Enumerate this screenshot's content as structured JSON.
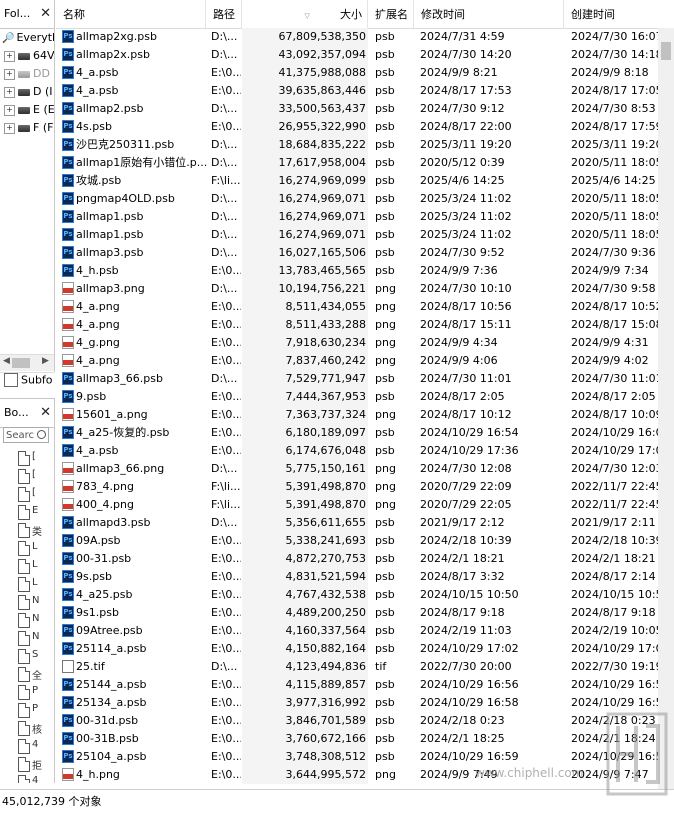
{
  "folders": {
    "title": "Fol...",
    "items": [
      {
        "expander": "",
        "icon": "search-root-icon",
        "label": "Everyth"
      },
      {
        "expander": "+",
        "icon": "network-drive-icon",
        "label": "64V"
      },
      {
        "expander": "+",
        "icon": "drive-icon",
        "label": "DD"
      },
      {
        "expander": "+",
        "icon": "drive-icon",
        "label": "D (I"
      },
      {
        "expander": "+",
        "icon": "drive-icon",
        "label": "E (E"
      },
      {
        "expander": "+",
        "icon": "drive-icon",
        "label": "F (F"
      }
    ],
    "subfolders_label": "Subfo"
  },
  "bookmarks": {
    "title": "Bo...",
    "search_placeholder": "Searc",
    "items": [
      "[",
      "[",
      "[",
      "E",
      "类",
      "L",
      "L",
      "L",
      "N",
      "N",
      "N",
      "S",
      "全",
      "P",
      "P",
      "核",
      "4",
      "拒",
      "4"
    ]
  },
  "columns": {
    "name": "名称",
    "path": "路径",
    "size": "大小",
    "ext": "扩展名",
    "modified": "修改时间",
    "created": "创建时间"
  },
  "files": [
    {
      "name": "allmap2xg.psb",
      "path": "D:\\...",
      "size": "67,809,538,350",
      "ext": "psb",
      "modified": "2024/7/31 4:59",
      "created": "2024/7/30 16:07",
      "icon": "psb"
    },
    {
      "name": "allmap2x.psb",
      "path": "D:\\...",
      "size": "43,092,357,094",
      "ext": "psb",
      "modified": "2024/7/30 14:20",
      "created": "2024/7/30 14:18",
      "icon": "psb"
    },
    {
      "name": "4_a.psb",
      "path": "E:\\0...",
      "size": "41,375,988,088",
      "ext": "psb",
      "modified": "2024/9/9 8:21",
      "created": "2024/9/9 8:18",
      "icon": "psb"
    },
    {
      "name": "4_a.psb",
      "path": "E:\\0...",
      "size": "39,635,863,446",
      "ext": "psb",
      "modified": "2024/8/17 17:53",
      "created": "2024/8/17 17:05",
      "icon": "psb"
    },
    {
      "name": "allmap2.psb",
      "path": "D:\\...",
      "size": "33,500,563,437",
      "ext": "psb",
      "modified": "2024/7/30 9:12",
      "created": "2024/7/30 8:53",
      "icon": "psb"
    },
    {
      "name": "4s.psb",
      "path": "E:\\0...",
      "size": "26,955,322,990",
      "ext": "psb",
      "modified": "2024/8/17 22:00",
      "created": "2024/8/17 17:59",
      "icon": "psb"
    },
    {
      "name": "沙巴克250311.psb",
      "path": "D:\\...",
      "size": "18,684,835,222",
      "ext": "psb",
      "modified": "2025/3/11 19:20",
      "created": "2025/3/11 19:20",
      "icon": "psb"
    },
    {
      "name": "allmap1原始有小错位.p...",
      "path": "D:\\...",
      "size": "17,617,958,004",
      "ext": "psb",
      "modified": "2020/5/12 0:39",
      "created": "2020/5/11 18:05",
      "icon": "psb"
    },
    {
      "name": "攻城.psb",
      "path": "F:\\li...",
      "size": "16,274,969,099",
      "ext": "psb",
      "modified": "2025/4/6 14:25",
      "created": "2025/4/6 14:25",
      "icon": "psb"
    },
    {
      "name": "pngmap4OLD.psb",
      "path": "D:\\...",
      "size": "16,274,969,071",
      "ext": "psb",
      "modified": "2025/3/24 11:02",
      "created": "2020/5/11 18:05",
      "icon": "psb"
    },
    {
      "name": "allmap1.psb",
      "path": "D:\\...",
      "size": "16,274,969,071",
      "ext": "psb",
      "modified": "2025/3/24 11:02",
      "created": "2020/5/11 18:05",
      "icon": "psb"
    },
    {
      "name": "allmap1.psb",
      "path": "D:\\...",
      "size": "16,274,969,071",
      "ext": "psb",
      "modified": "2025/3/24 11:02",
      "created": "2020/5/11 18:05",
      "icon": "psb"
    },
    {
      "name": "allmap3.psb",
      "path": "D:\\...",
      "size": "16,027,165,506",
      "ext": "psb",
      "modified": "2024/7/30 9:52",
      "created": "2024/7/30 9:36",
      "icon": "psb"
    },
    {
      "name": "4_h.psb",
      "path": "E:\\0...",
      "size": "13,783,465,565",
      "ext": "psb",
      "modified": "2024/9/9 7:36",
      "created": "2024/9/9 7:34",
      "icon": "psb"
    },
    {
      "name": "allmap3.png",
      "path": "D:\\...",
      "size": "10,194,756,221",
      "ext": "png",
      "modified": "2024/7/30 10:10",
      "created": "2024/7/30 9:58",
      "icon": "png"
    },
    {
      "name": "4_a.png",
      "path": "E:\\0...",
      "size": "8,511,434,055",
      "ext": "png",
      "modified": "2024/8/17 10:56",
      "created": "2024/8/17 10:52",
      "icon": "png"
    },
    {
      "name": "4_a.png",
      "path": "E:\\0...",
      "size": "8,511,433,288",
      "ext": "png",
      "modified": "2024/8/17 15:11",
      "created": "2024/8/17 15:08",
      "icon": "png"
    },
    {
      "name": "4_g.png",
      "path": "E:\\0...",
      "size": "7,918,630,234",
      "ext": "png",
      "modified": "2024/9/9 4:34",
      "created": "2024/9/9 4:31",
      "icon": "png"
    },
    {
      "name": "4_a.png",
      "path": "E:\\0...",
      "size": "7,837,460,242",
      "ext": "png",
      "modified": "2024/9/9 4:06",
      "created": "2024/9/9 4:02",
      "icon": "png"
    },
    {
      "name": "allmap3_66.psb",
      "path": "D:\\...",
      "size": "7,529,771,947",
      "ext": "psb",
      "modified": "2024/7/30 11:01",
      "created": "2024/7/30 11:01",
      "icon": "psb"
    },
    {
      "name": "9.psb",
      "path": "E:\\0...",
      "size": "7,444,367,953",
      "ext": "psb",
      "modified": "2024/8/17 2:05",
      "created": "2024/8/17 2:05",
      "icon": "psb"
    },
    {
      "name": "15601_a.png",
      "path": "E:\\0...",
      "size": "7,363,737,324",
      "ext": "png",
      "modified": "2024/8/17 10:12",
      "created": "2024/8/17 10:09",
      "icon": "png"
    },
    {
      "name": "4_a25-恢复的.psb",
      "path": "E:\\0...",
      "size": "6,180,189,097",
      "ext": "psb",
      "modified": "2024/10/29 16:54",
      "created": "2024/10/29 16:08",
      "icon": "psb"
    },
    {
      "name": "4_a.psb",
      "path": "E:\\0...",
      "size": "6,174,676,048",
      "ext": "psb",
      "modified": "2024/10/29 17:36",
      "created": "2024/10/29 17:02",
      "icon": "psb"
    },
    {
      "name": "allmap3_66.png",
      "path": "D:\\...",
      "size": "5,775,150,161",
      "ext": "png",
      "modified": "2024/7/30 12:08",
      "created": "2024/7/30 12:03",
      "icon": "png"
    },
    {
      "name": "783_4.png",
      "path": "F:\\li...",
      "size": "5,391,498,870",
      "ext": "png",
      "modified": "2020/7/29 22:09",
      "created": "2022/11/7 22:45",
      "icon": "png"
    },
    {
      "name": "400_4.png",
      "path": "F:\\li...",
      "size": "5,391,498,870",
      "ext": "png",
      "modified": "2020/7/29 22:05",
      "created": "2022/11/7 22:45",
      "icon": "png"
    },
    {
      "name": "allmapd3.psb",
      "path": "D:\\...",
      "size": "5,356,611,655",
      "ext": "psb",
      "modified": "2021/9/17 2:12",
      "created": "2021/9/17 2:11",
      "icon": "psb"
    },
    {
      "name": "09A.psb",
      "path": "E:\\0...",
      "size": "5,338,241,693",
      "ext": "psb",
      "modified": "2024/2/18 10:39",
      "created": "2024/2/18 10:39",
      "icon": "psb"
    },
    {
      "name": "00-31.psb",
      "path": "E:\\0...",
      "size": "4,872,270,753",
      "ext": "psb",
      "modified": "2024/2/1 18:21",
      "created": "2024/2/1 18:21",
      "icon": "psb"
    },
    {
      "name": "9s.psb",
      "path": "E:\\0...",
      "size": "4,831,521,594",
      "ext": "psb",
      "modified": "2024/8/17 3:32",
      "created": "2024/8/17 2:14",
      "icon": "psb"
    },
    {
      "name": "4_a25.psb",
      "path": "E:\\0...",
      "size": "4,767,432,538",
      "ext": "psb",
      "modified": "2024/10/15 10:50",
      "created": "2024/10/15 10:50",
      "icon": "psb"
    },
    {
      "name": "9s1.psb",
      "path": "E:\\0...",
      "size": "4,489,200,250",
      "ext": "psb",
      "modified": "2024/8/17 9:18",
      "created": "2024/8/17 9:18",
      "icon": "psb"
    },
    {
      "name": "09Atree.psb",
      "path": "E:\\0...",
      "size": "4,160,337,564",
      "ext": "psb",
      "modified": "2024/2/19 11:03",
      "created": "2024/2/19 10:05",
      "icon": "psb"
    },
    {
      "name": "25114_a.psb",
      "path": "E:\\0...",
      "size": "4,150,882,164",
      "ext": "psb",
      "modified": "2024/10/29 17:02",
      "created": "2024/10/29 17:01",
      "icon": "psb"
    },
    {
      "name": "25.tif",
      "path": "D:\\...",
      "size": "4,123,494,836",
      "ext": "tif",
      "modified": "2022/7/30 20:00",
      "created": "2022/7/30 19:19",
      "icon": "tif"
    },
    {
      "name": "25144_a.psb",
      "path": "E:\\0...",
      "size": "4,115,889,857",
      "ext": "psb",
      "modified": "2024/10/29 16:56",
      "created": "2024/10/29 16:56",
      "icon": "psb"
    },
    {
      "name": "25134_a.psb",
      "path": "E:\\0...",
      "size": "3,977,316,992",
      "ext": "psb",
      "modified": "2024/10/29 16:58",
      "created": "2024/10/29 16:58",
      "icon": "psb"
    },
    {
      "name": "00-31d.psb",
      "path": "E:\\0...",
      "size": "3,846,701,589",
      "ext": "psb",
      "modified": "2024/2/18 0:23",
      "created": "2024/2/18 0:23",
      "icon": "psb"
    },
    {
      "name": "00-31B.psb",
      "path": "E:\\0...",
      "size": "3,760,672,166",
      "ext": "psb",
      "modified": "2024/2/1 18:25",
      "created": "2024/2/1 18:24",
      "icon": "psb"
    },
    {
      "name": "25104_a.psb",
      "path": "E:\\0...",
      "size": "3,748,308,512",
      "ext": "psb",
      "modified": "2024/10/29 16:59",
      "created": "2024/10/29 16:59",
      "icon": "psb"
    },
    {
      "name": "4_h.png",
      "path": "E:\\0...",
      "size": "3,644,995,572",
      "ext": "png",
      "modified": "2024/9/9 7:49",
      "created": "2024/9/9 7:47",
      "icon": "png"
    }
  ],
  "status": {
    "count_text": "45,012,739 个对象"
  },
  "watermark": {
    "text": "www.chiphell.com"
  }
}
